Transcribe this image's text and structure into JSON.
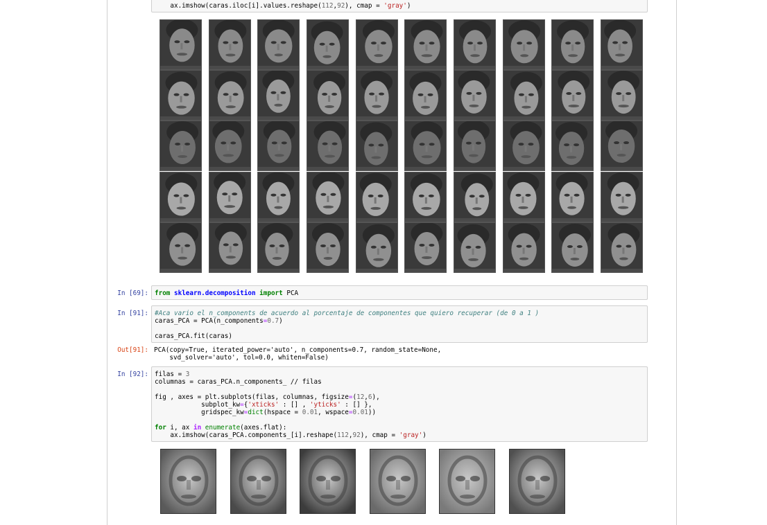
{
  "cells": {
    "top_code_line": "ax.imshow(caras.iloc[i].values.reshape(112,92), cmap = 'gray')",
    "cell69": {
      "prompt": "In [69]:",
      "tokens": [
        "from",
        "sklearn.decomposition",
        "import",
        "PCA"
      ]
    },
    "cell91": {
      "prompt": "In [91]:",
      "comment": "#Aca vario el n_components de acuerdo al porcentaje de componentes que quiero recuperar (de 0 a 1 )",
      "line2": "caras_PCA = PCA(n_components=0.7)",
      "line3": "caras_PCA.fit(caras)"
    },
    "out91": {
      "prompt": "Out[91]:",
      "line1": "PCA(copy=True, iterated_power='auto', n_components=0.7, random_state=None,",
      "line2": "    svd_solver='auto', tol=0.0, whiten=False)"
    },
    "cell92": {
      "prompt": "In [92]:",
      "line1": "filas = 3",
      "line2": "columnas = caras_PCA.n_components_ // filas",
      "line3": "fig , axes = plt.subplots(filas, columnas, figsize=(12,6),",
      "line4": "            subplot_kw={'xticks' : [] , 'yticks' : [] },",
      "line5": "            gridspec_kw=dict(hspace = 0.01, wspace=0.01))",
      "line6": "for i, ax in enumerate(axes.flat):",
      "line7": "    ax.imshow(caras_PCA.components_[i].reshape(112,92), cmap = 'gray')"
    }
  },
  "face_grid": {
    "rows": 5,
    "cols": 10,
    "subject_tones": [
      "#8a8a8a",
      "#9a9a9a",
      "#6e6e6e",
      "#a8a8a8",
      "#909090"
    ]
  },
  "eigenfaces": {
    "count": 6,
    "tones": [
      "#5a5a5a",
      "#4a4a4a",
      "#3c3c3c",
      "#6a6a6a",
      "#7a7a7a",
      "#505050"
    ]
  }
}
